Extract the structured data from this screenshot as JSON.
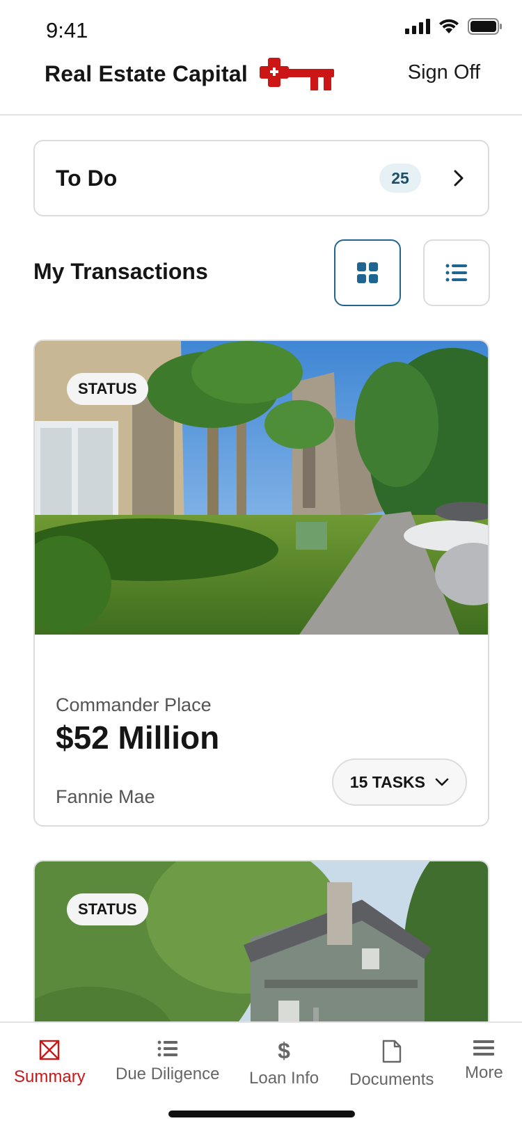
{
  "status_bar": {
    "time": "9:41"
  },
  "header": {
    "title": "Real Estate Capital",
    "sign_off_label": "Sign Off"
  },
  "todo": {
    "label": "To Do",
    "count": "25"
  },
  "transactions": {
    "title": "My Transactions",
    "view_modes": [
      "grid-view-icon",
      "list-view-icon"
    ],
    "active_view": "grid",
    "items": [
      {
        "status": "STATUS",
        "name": "Commander Place",
        "amount": "$52 Million",
        "lender": "Fannie Mae",
        "tasks_label": "15 TASKS"
      },
      {
        "status": "STATUS"
      }
    ]
  },
  "tab_bar": {
    "active": "Summary",
    "items": [
      {
        "label": "Summary",
        "icon": "summary-icon"
      },
      {
        "label": "Due Diligence",
        "icon": "checklist-icon"
      },
      {
        "label": "Loan Info",
        "icon": "dollar-icon"
      },
      {
        "label": "Documents",
        "icon": "document-icon"
      },
      {
        "label": "More",
        "icon": "menu-icon"
      }
    ]
  },
  "colors": {
    "brand_red": "#cc1616",
    "accent_blue": "#1f6592",
    "badge_bg": "#e6f1f6"
  }
}
